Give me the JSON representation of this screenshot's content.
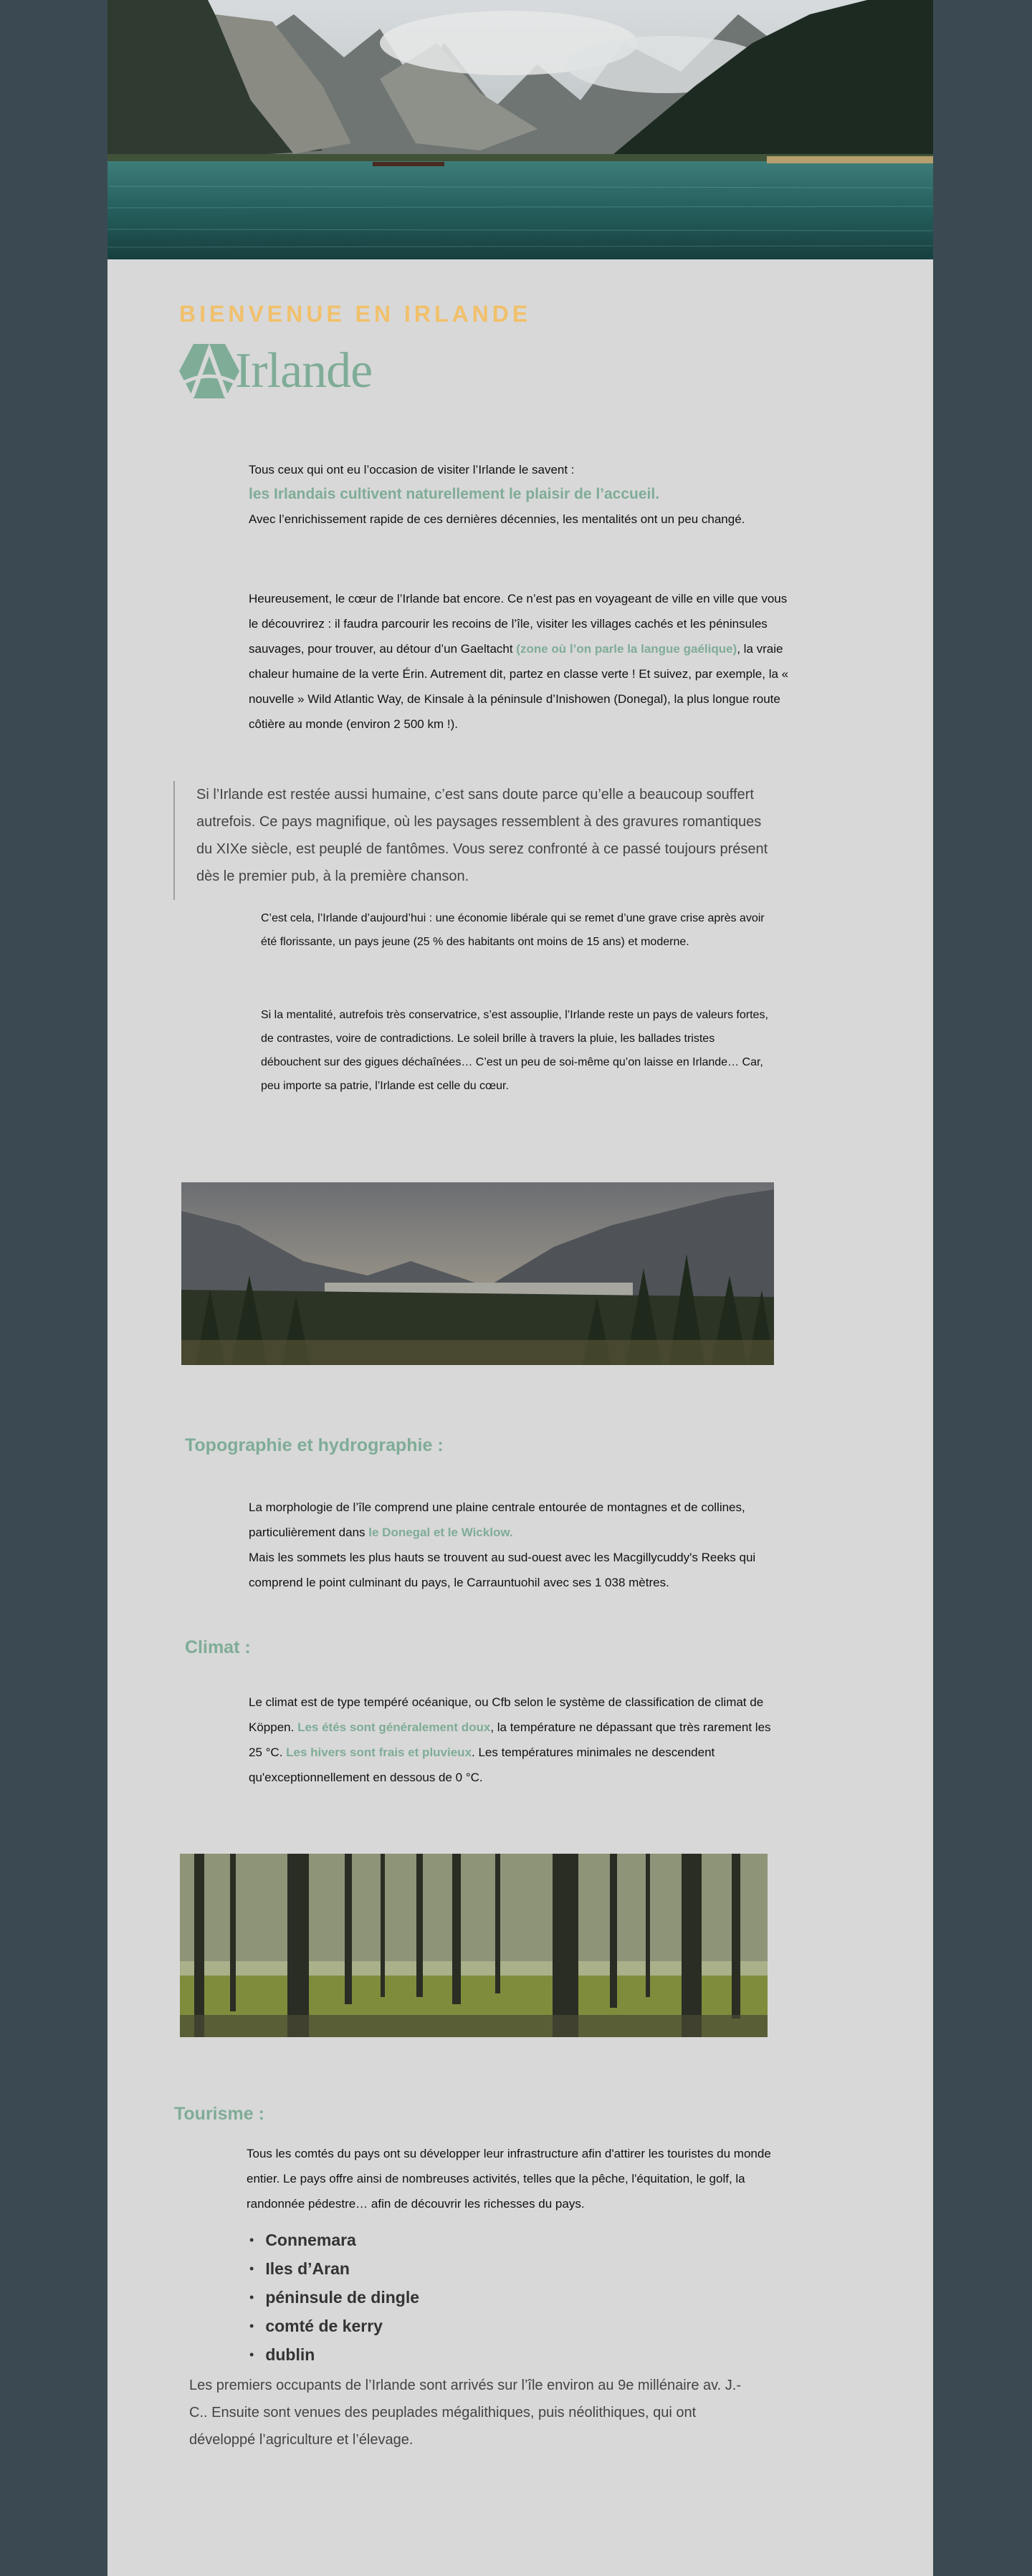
{
  "header": {
    "welcome": "BIENVENUE EN IRLANDE",
    "logo_text": "Irlande"
  },
  "intro": {
    "line1": "Tous ceux qui ont eu l’occasion de visiter l’Irlande le savent :",
    "highlight": "les Irlandais cultivent naturellement le plaisir de l’accueil.",
    "line3": "Avec l’enrichissement rapide de ces dernières décennies, les mentalités ont un peu changé."
  },
  "paragraph2": {
    "before": "Heureusement, le cœur de l’Irlande bat encore. Ce n’est pas en voyageant de ville en ville que vous le découvrirez : il faudra parcourir les recoins de l’île, visiter les villages cachés et les péninsules sauvages, pour trouver, au détour d’un Gaeltacht ",
    "accent": "(zone où l’on parle la langue gaélique)",
    "after": ", la vraie chaleur humaine de la verte Érin. Autrement dit, partez en classe verte ! Et suivez, par exemple, la « nouvelle » Wild Atlantic Way, de Kinsale à la péninsule d’Inishowen (Donegal), la plus longue route côtière au monde (environ 2 500 km !)."
  },
  "quote": "Si l’Irlande est restée aussi humaine, c’est sans doute parce qu’elle a beaucoup souffert autrefois. Ce pays magnifique, où les paysages ressemblent à des gravures romantiques du XIXe siècle, est peuplé de fantômes. Vous serez confronté à ce passé toujours présent dès le premier pub, à la première chanson.",
  "paragraph3": "C’est cela, l’Irlande d’aujourd’hui : une économie libérale qui se remet d’une grave crise après avoir été florissante, un pays jeune (25 % des habitants ont moins de 15 ans) et moderne.",
  "paragraph4": "Si la mentalité, autrefois très conservatrice, s’est assouplie, l’Irlande reste un pays de valeurs fortes, de contrastes, voire de contradictions. Le soleil brille à travers la pluie, les ballades tristes débouchent sur des gigues déchaînées… C’est un peu de soi-même qu’on laisse en Irlande… Car, peu importe sa patrie, l’Irlande est celle du cœur.",
  "topography": {
    "title": "Topographie et hydrographie :",
    "before": "La morphologie de l’île comprend une plaine centrale entourée de montagnes et de collines, particulièrement dans ",
    "accent": "le Donegal et le Wicklow.",
    "after": "Mais les sommets les plus hauts se trouvent au sud-ouest avec les Macgillycuddy's Reeks qui comprend le point culminant du pays, le Carrauntuohil avec ses 1 038 mètres."
  },
  "climate": {
    "title": "Climat :",
    "part1": "Le climat est de type tempéré océanique, ou Cfb selon le système de classification de climat de Köppen. ",
    "accent1": "Les étés sont généralement doux",
    "part2": ", la température ne dépassant que très rarement les 25 °C. ",
    "accent2": "Les hivers sont frais et pluvieux",
    "part3": ". Les températures minimales ne descendent qu'exceptionnellement en dessous de 0 °C."
  },
  "tourism": {
    "title": "Tourisme :",
    "text": "Tous les comtés du pays ont su développer leur infrastructure afin d'attirer les touristes du monde entier. Le pays offre ainsi de nombreuses activités, telles que la pêche, l'équitation, le golf, la randonnée pédestre… afin de découvrir les richesses du pays.",
    "items": [
      "Connemara",
      "Iles d’Aran",
      "péninsule de dingle",
      "comté de kerry",
      "dublin"
    ]
  },
  "final": "Les premiers occupants de l’Irlande sont arrivés sur l’île environ au 9e millénaire av. J.-C.. Ensuite sont venues des peuplades mégalithiques, puis néolithiques, qui ont développé l’agriculture et l’élevage.",
  "colors": {
    "accent": "#7fac97",
    "welcome": "#f1c06b",
    "background": "#3b4a52",
    "page": "#d8d8d8"
  }
}
